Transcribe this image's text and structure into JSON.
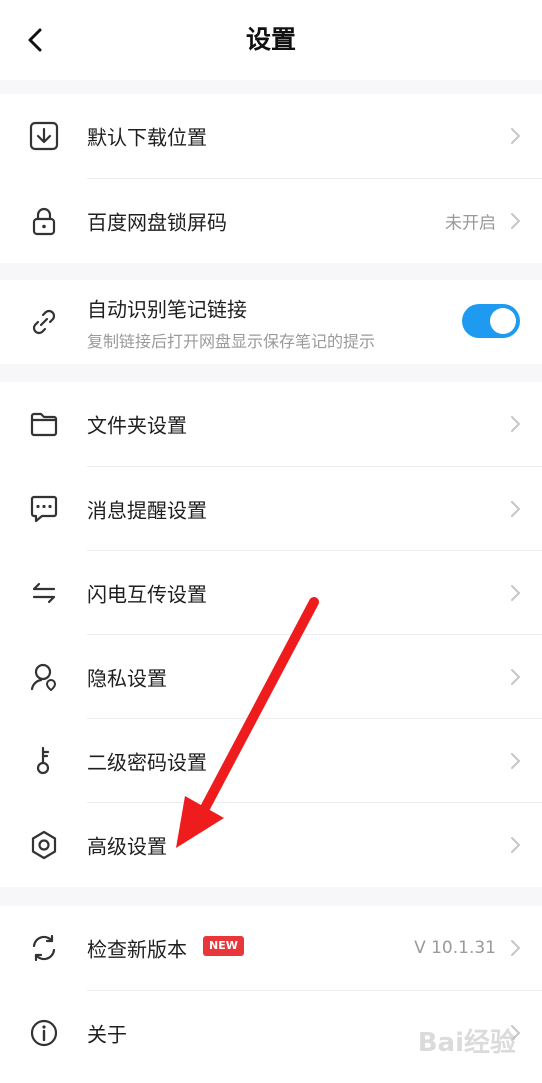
{
  "header": {
    "title": "设置"
  },
  "colors": {
    "accent": "#1e9bf0",
    "badge": "#e8363a",
    "annotation_arrow": "#ee1c1c"
  },
  "rows": {
    "download": {
      "label": "默认下载位置",
      "icon": "download-icon"
    },
    "lock": {
      "label": "百度网盘锁屏码",
      "value": "未开启",
      "icon": "lock-icon"
    },
    "autolink": {
      "label": "自动识别笔记链接",
      "sub": "复制链接后打开网盘显示保存笔记的提示",
      "toggle_on": true,
      "icon": "link-icon"
    },
    "folder": {
      "label": "文件夹设置",
      "icon": "folder-icon"
    },
    "message": {
      "label": "消息提醒设置",
      "icon": "message-icon"
    },
    "transfer": {
      "label": "闪电互传设置",
      "icon": "transfer-arrows-icon"
    },
    "privacy": {
      "label": "隐私设置",
      "icon": "privacy-icon"
    },
    "password": {
      "label": "二级密码设置",
      "icon": "key-icon"
    },
    "advanced": {
      "label": "高级设置",
      "icon": "gear-icon"
    },
    "update": {
      "label": "检查新版本",
      "badge": "NEW",
      "value": "V 10.1.31",
      "icon": "refresh-icon"
    },
    "about": {
      "label": "关于",
      "icon": "info-icon"
    }
  },
  "watermark": "Bai经验"
}
